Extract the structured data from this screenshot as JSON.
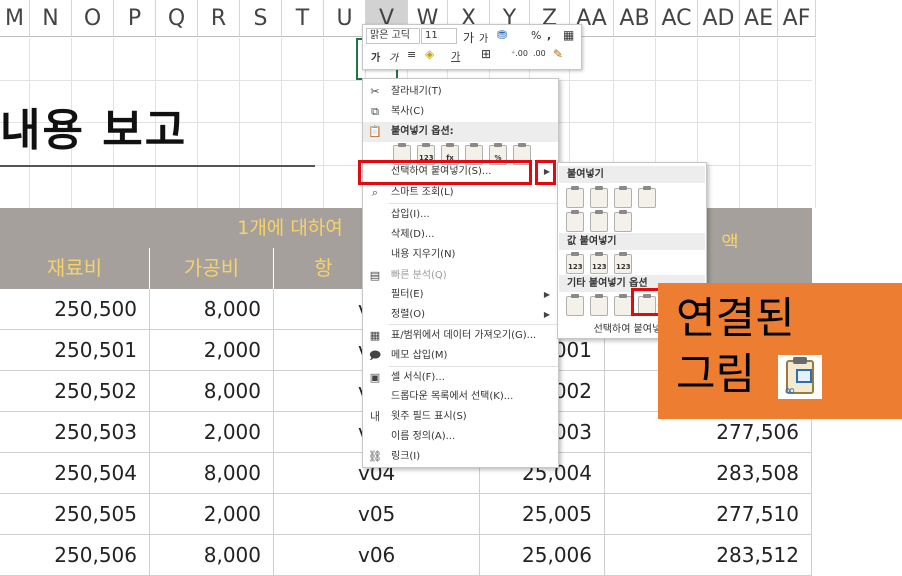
{
  "column_headers": [
    "M",
    "N",
    "O",
    "P",
    "Q",
    "R",
    "S",
    "T",
    "U",
    "V",
    "W",
    "X",
    "Y",
    "Z",
    "AA",
    "AB",
    "AC",
    "AD",
    "AE",
    "AF"
  ],
  "selected_column": "V",
  "report_title": "내용 보고",
  "table": {
    "group_header": "1개에 대하여",
    "group_header_right": "액",
    "headers": [
      "재료비",
      "가공비",
      "항"
    ],
    "rows": [
      [
        "250,500",
        "8,000",
        "v",
        "",
        ""
      ],
      [
        "250,501",
        "2,000",
        "v",
        "001",
        ""
      ],
      [
        "250,502",
        "8,000",
        "v",
        "002",
        ""
      ],
      [
        "250,503",
        "2,000",
        "v",
        "003",
        "277,506"
      ],
      [
        "250,504",
        "8,000",
        "v04",
        "25,004",
        "283,508"
      ],
      [
        "250,505",
        "2,000",
        "v05",
        "25,005",
        "277,510"
      ],
      [
        "250,506",
        "8,000",
        "v06",
        "25,006",
        "283,512"
      ]
    ]
  },
  "mini_toolbar": {
    "font_name": "맑은 고딕",
    "font_size": "11",
    "grow_font": "가",
    "shrink_font": "가",
    "currency": "%",
    "comma": ",",
    "bold": "가",
    "italic": "가",
    "font_color_letter": "가"
  },
  "context_menu": {
    "items": [
      {
        "label": "잘라내기(T)",
        "icon": "scissors-icon"
      },
      {
        "label": "복사(C)",
        "icon": "copy-icon"
      },
      {
        "label": "붙여넣기 옵션:",
        "icon": "paste-icon"
      },
      {
        "label": "선택하여 붙여넣기(S)...",
        "icon": ""
      },
      {
        "label": "스마트 조회(L)",
        "icon": "smart-lookup-icon"
      },
      {
        "label": "삽입(I)...",
        "icon": ""
      },
      {
        "label": "삭제(D)...",
        "icon": ""
      },
      {
        "label": "내용 지우기(N)",
        "icon": ""
      },
      {
        "label": "빠른 분석(Q)",
        "icon": "quick-analysis-icon"
      },
      {
        "label": "필터(E)",
        "icon": ""
      },
      {
        "label": "정렬(O)",
        "icon": ""
      },
      {
        "label": "표/범위에서 데이터 가져오기(G)...",
        "icon": "table-icon"
      },
      {
        "label": "메모 삽입(M)",
        "icon": "comment-icon"
      },
      {
        "label": "셀 서식(F)...",
        "icon": "format-cells-icon"
      },
      {
        "label": "드롭다운 목록에서 선택(K)...",
        "icon": ""
      },
      {
        "label": "윗주 필드 표시(S)",
        "icon": "phonetic-icon"
      },
      {
        "label": "이름 정의(A)...",
        "icon": ""
      },
      {
        "label": "링크(I)",
        "icon": "link-icon"
      }
    ],
    "paste_option_tags": [
      "",
      "123",
      "fx",
      "",
      "%",
      ""
    ]
  },
  "submenu": {
    "section_paste": "붙여넣기",
    "section_values": "값 붙여넣기",
    "section_other": "기타 붙여넣기 옵션",
    "footer": "선택하여 붙여넣기",
    "value_tags": [
      "123",
      "123",
      "123"
    ]
  },
  "callout": {
    "text": "연결된\n그림"
  },
  "colors": {
    "header_band": "#a5a09c",
    "header_text": "#f5d36a",
    "highlight_red": "#e3090f",
    "callout_orange": "#ed7d31",
    "excel_green": "#217346"
  }
}
